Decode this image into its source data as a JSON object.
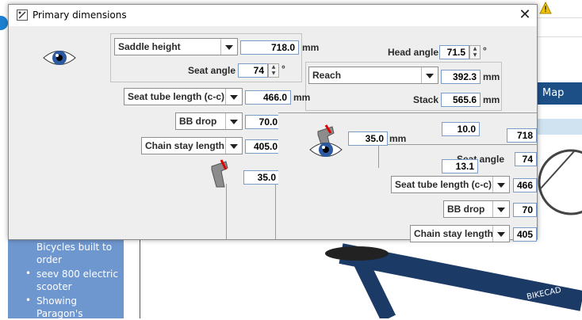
{
  "background": {
    "nav_map": "Map",
    "sidebar_items": [
      {
        "text": "Bicycles built to order",
        "bullet": false
      },
      {
        "text": "seev 800 electric scooter",
        "bullet": true
      },
      {
        "text": "Showing Paragon's",
        "bullet": true
      }
    ],
    "frame_text": "BIKECAD"
  },
  "dialog": {
    "title": "Primary dimensions",
    "saddle": {
      "label": "Saddle height",
      "value": "718.0",
      "unit": "mm"
    },
    "seat_angle": {
      "label": "Seat angle",
      "value": "74",
      "unit": "°"
    },
    "head_angle": {
      "label": "Head angle",
      "value": "71.5",
      "unit": "°"
    },
    "reach": {
      "label": "Reach",
      "value": "392.3",
      "unit": "mm"
    },
    "stack": {
      "label": "Stack",
      "value": "565.6",
      "unit": "mm"
    },
    "seat_tube": {
      "label": "Seat tube length (c-c)",
      "value": "466.0",
      "unit": "mm"
    },
    "bb_drop": {
      "label": "BB drop",
      "value": "70.0"
    },
    "chain_stay": {
      "label": "Chain stay length",
      "value": "405.0"
    },
    "lower_field": {
      "value": "35.0"
    },
    "overlay": {
      "field_35": "35.0",
      "unit_mm": "mm",
      "field_10": "10.0",
      "field_718": "718",
      "seat_angle_label": "Seat angle",
      "field_74": "74",
      "field_131": "13.1",
      "seat_tube_label": "Seat tube length (c-c)",
      "field_466": "466",
      "bb_drop_label": "BB drop",
      "field_70": "70",
      "chain_stay_label": "Chain stay length",
      "field_405": "405"
    }
  }
}
